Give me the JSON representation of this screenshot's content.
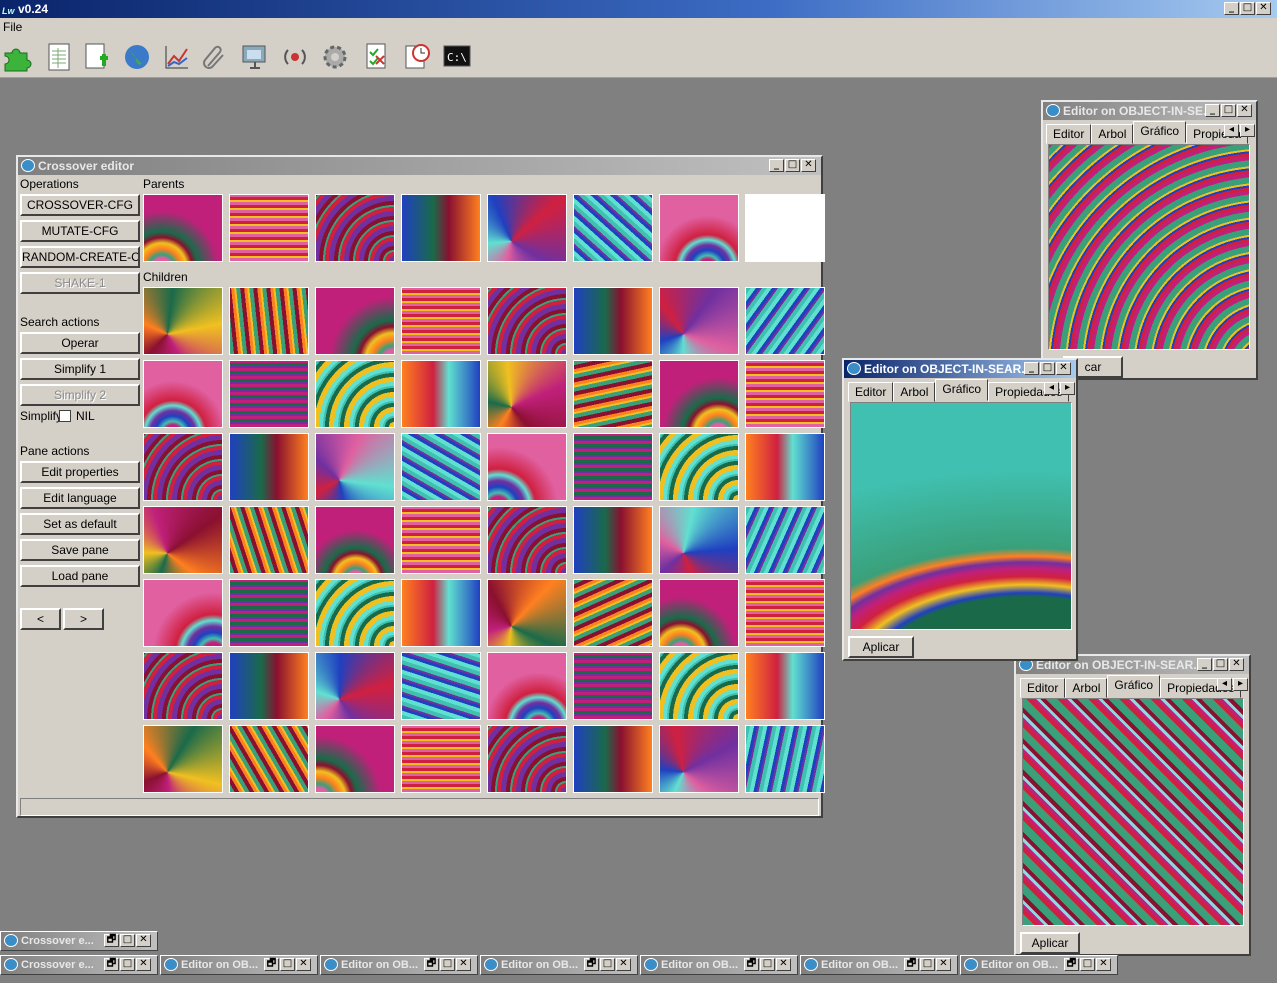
{
  "app": {
    "title": "v0.24",
    "logo": "Lw"
  },
  "menu": {
    "file": "File"
  },
  "toolbar": {
    "icons": [
      "puzzle-icon",
      "spreadsheet-icon",
      "new-document-icon",
      "globe-icon",
      "chart-icon",
      "paperclip-icon",
      "monitor-icon",
      "broadcast-icon",
      "gear-icon",
      "checklist-icon",
      "clock-document-icon",
      "console-icon"
    ]
  },
  "window_buttons": {
    "min": "_",
    "max": "□",
    "restore": "🗗",
    "close": "✕"
  },
  "crossover": {
    "title": "Crossover editor",
    "operations_label": "Operations",
    "parents_label": "Parents",
    "children_label": "Children",
    "ops": [
      "CROSSOVER-CFG",
      "MUTATE-CFG",
      "RANDOM-CREATE-CFG",
      "SHAKE-1"
    ],
    "search_label": "Search actions",
    "search": [
      "Operar",
      "Simplify 1",
      "Simplify 2"
    ],
    "simplify_label": "Simplify",
    "simplify_value": "NIL",
    "pane_label": "Pane actions",
    "pane": [
      "Edit properties",
      "Edit language",
      "Set as default",
      "Save pane",
      "Load pane"
    ],
    "nav": {
      "prev": "<",
      "next": ">"
    }
  },
  "editor1": {
    "title": "Editor on OBJECT-IN-SE...",
    "tabs": [
      "Editor",
      "Arbol",
      "Gráfico",
      "Propieda"
    ],
    "apply": "car"
  },
  "editor2": {
    "title": "Editor on OBJECT-IN-SEAR...",
    "tabs": [
      "Editor",
      "Arbol",
      "Gráfico",
      "Propiedades"
    ],
    "apply": "Aplicar"
  },
  "editor3": {
    "title": "Editor on OBJECT-IN-SEAR...",
    "tabs": [
      "Editor",
      "Arbol",
      "Gráfico",
      "Propiedades"
    ],
    "apply": "Aplicar"
  },
  "taskbar": {
    "row1": [
      "Crossover e..."
    ],
    "row2": [
      "Crossover e...",
      "Editor on OB...",
      "Editor on OB...",
      "Editor on OB...",
      "Editor on OB...",
      "Editor on OB...",
      "Editor on OB..."
    ]
  },
  "colors": {
    "teal": "#3aa07a",
    "magenta": "#c0207a",
    "red": "#d02040",
    "navy": "#0a246a",
    "face": "#d4d0c8"
  }
}
